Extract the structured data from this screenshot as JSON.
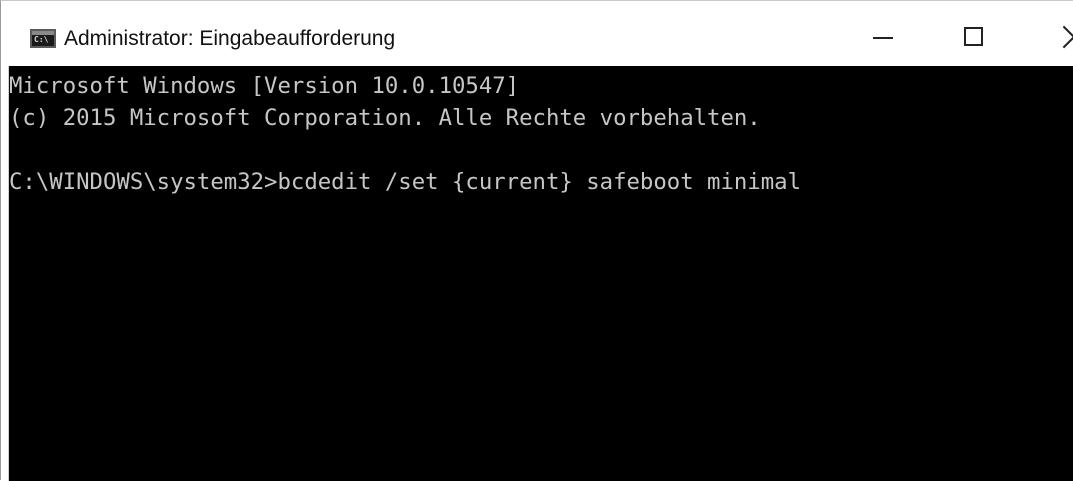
{
  "window": {
    "title": "Administrator: Eingabeaufforderung",
    "icon": "cmd-console-icon",
    "icon_glyph": "C:\\",
    "controls": {
      "minimize_icon": "minimize-icon",
      "maximize_icon": "maximize-icon",
      "close_icon": "close-icon"
    }
  },
  "console": {
    "background_color": "#000000",
    "text_color": "#c6c6c6",
    "lines": [
      "Microsoft Windows [Version 10.0.10547]",
      "(c) 2015 Microsoft Corporation. Alle Rechte vorbehalten.",
      "",
      "C:\\WINDOWS\\system32>bcdedit /set {current} safeboot minimal"
    ]
  }
}
